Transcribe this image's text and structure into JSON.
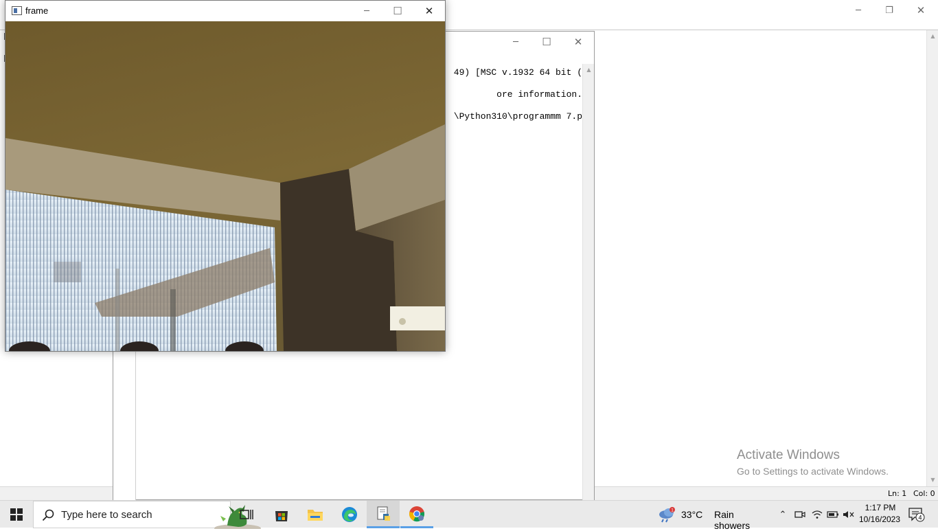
{
  "background_window": {
    "minimize_glyph": "─",
    "restore_glyph": "❐",
    "close_glyph": "✕",
    "status": {
      "line": "Ln: 1",
      "column": "Col: 0"
    }
  },
  "shell_window": {
    "minimize_glyph": "─",
    "maximize_glyph": "☐",
    "close_glyph": "✕",
    "lines": [
      "49) [MSC v.1932 64 bit (",
      "ore information.",
      "\\Python310\\programmm 7.p"
    ]
  },
  "frame_window": {
    "title": "frame",
    "minimize_glyph": "─",
    "maximize_glyph": "☐",
    "close_glyph": "✕"
  },
  "taskbar": {
    "search_placeholder": "Type here to search",
    "pinned": [
      "task-view-icon",
      "microsoft-store-icon",
      "file-explorer-icon",
      "edge-icon",
      "python-idle-icon",
      "chrome-icon"
    ],
    "weather": {
      "temperature": "33°C",
      "description": "Rain showers",
      "badge": "1"
    },
    "clock": {
      "time": "1:17 PM",
      "date": "10/16/2023"
    },
    "notification_count": "4"
  },
  "watermark": {
    "title": "Activate Windows",
    "subtitle": "Go to Settings to activate Windows."
  }
}
